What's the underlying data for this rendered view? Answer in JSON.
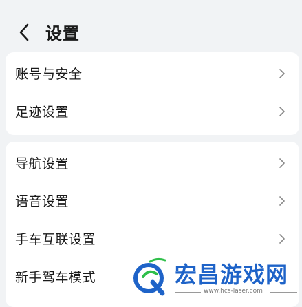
{
  "header": {
    "title": "设置",
    "back_icon": "chevron-left-icon"
  },
  "groups": [
    {
      "items": [
        {
          "label": "账号与安全"
        },
        {
          "label": "足迹设置"
        }
      ]
    },
    {
      "items": [
        {
          "label": "导航设置"
        },
        {
          "label": "语音设置"
        },
        {
          "label": "手车互联设置"
        },
        {
          "label": "新手驾车模式"
        }
      ]
    }
  ],
  "watermark": {
    "name": "宏昌游戏网",
    "url": "www.hcs-laser.com"
  },
  "colors": {
    "background": "#f1f3f5",
    "card": "#ffffff",
    "text": "#1a1a1a",
    "chevron": "#8a8a8a",
    "watermark": "#1e63c8"
  }
}
